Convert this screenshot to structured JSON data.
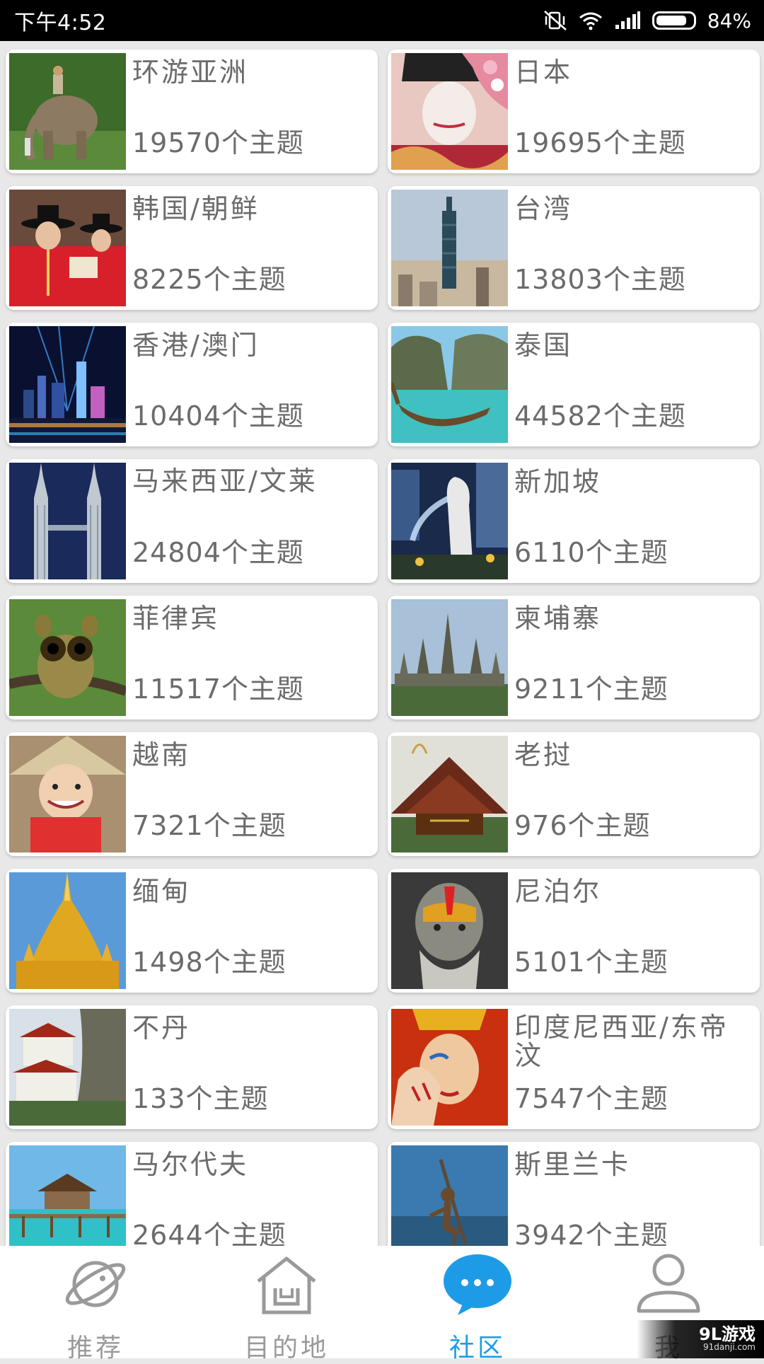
{
  "status_bar": {
    "time": "下午4:52",
    "battery": "84%",
    "battery_level": 0.84
  },
  "destinations": [
    {
      "name": "环游亚洲",
      "count": "19570个主题",
      "icon": "elephant-photo"
    },
    {
      "name": "日本",
      "count": "19695个主题",
      "icon": "geisha-photo"
    },
    {
      "name": "韩国/朝鲜",
      "count": "8225个主题",
      "icon": "korean-guards-photo"
    },
    {
      "name": "台湾",
      "count": "13803个主题",
      "icon": "taipei-101-photo"
    },
    {
      "name": "香港/澳门",
      "count": "10404个主题",
      "icon": "hong-kong-skyline-photo"
    },
    {
      "name": "泰国",
      "count": "44582个主题",
      "icon": "longtail-boat-photo"
    },
    {
      "name": "马来西亚/文莱",
      "count": "24804个主题",
      "icon": "petronas-towers-photo"
    },
    {
      "name": "新加坡",
      "count": "6110个主题",
      "icon": "merlion-photo"
    },
    {
      "name": "菲律宾",
      "count": "11517个主题",
      "icon": "tarsier-photo"
    },
    {
      "name": "柬埔寨",
      "count": "9211个主题",
      "icon": "angkor-wat-photo"
    },
    {
      "name": "越南",
      "count": "7321个主题",
      "icon": "vietnamese-child-photo"
    },
    {
      "name": "老挝",
      "count": "976个主题",
      "icon": "lao-temple-photo"
    },
    {
      "name": "缅甸",
      "count": "1498个主题",
      "icon": "golden-pagoda-photo"
    },
    {
      "name": "尼泊尔",
      "count": "5101个主题",
      "icon": "sadhu-photo"
    },
    {
      "name": "不丹",
      "count": "133个主题",
      "icon": "tigers-nest-photo"
    },
    {
      "name": "印度尼西亚/东帝汶",
      "count": "7547个主题",
      "icon": "balinese-dancer-photo"
    },
    {
      "name": "马尔代夫",
      "count": "2644个主题",
      "icon": "overwater-bungalow-photo"
    },
    {
      "name": "斯里兰卡",
      "count": "3942个主题",
      "icon": "stilt-fisherman-photo"
    }
  ],
  "bottom_nav": [
    {
      "label": "推荐",
      "icon": "planet-icon",
      "active": false
    },
    {
      "label": "目的地",
      "icon": "house-icon",
      "active": false
    },
    {
      "label": "社区",
      "icon": "chat-bubble-icon",
      "active": true
    },
    {
      "label": "我",
      "icon": "person-icon",
      "active": false
    }
  ],
  "watermark": {
    "main": "9L游戏",
    "sub": "91danji.com"
  },
  "colors": {
    "accent": "#1e9be6",
    "text": "#6b6b6b",
    "nav_inactive": "#9a9a9a"
  }
}
